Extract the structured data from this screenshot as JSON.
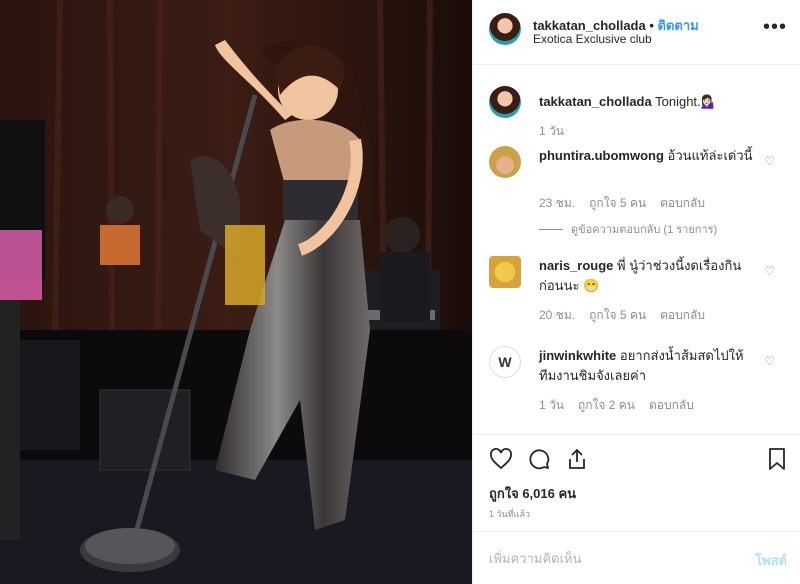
{
  "post": {
    "username": "takkatan_chollada",
    "dot": "•",
    "follow_label": "ติดตาม",
    "location": "Exotica Exclusive club",
    "more_icon": "more-options-icon",
    "caption": {
      "username": "takkatan_chollada",
      "text": "Tonight.💁🏻‍♀️",
      "age": "1 วัน"
    }
  },
  "comments": [
    {
      "username": "phuntira.ubomwong",
      "text": "อ้วนแท้ล่ะเด่วนี้",
      "age": "23 ชม.",
      "likes": "ถูกใจ 5 คน",
      "reply": "ตอบกลับ",
      "view_replies": "ดูข้อความตอบกลับ (1 รายการ)"
    },
    {
      "username": "naris_rouge",
      "text": "พี่ นู๋ว่าช่วงนี้งดเรื่องกินก่อนนะ 😁",
      "age": "20 ชม.",
      "likes": "ถูกใจ 5 คน",
      "reply": "ตอบกลับ"
    },
    {
      "username": "jinwinkwhite",
      "text": "อยากส่งน้ำส้มสดไปให้ทีมงานชิมจังเลยค่า",
      "age": "1 วัน",
      "likes": "ถูกใจ 2 คน",
      "reply": "ตอบกลับ"
    }
  ],
  "actions": {
    "likes": "ถูกใจ 6,016 คน",
    "time": "1 วันที่แล้ว"
  },
  "add_comment": {
    "placeholder": "เพิ่มความคิดเห็น",
    "post_label": "โพสต์"
  },
  "colors": {
    "link": "#3897f0",
    "muted": "#8e8e8e",
    "text": "#262626",
    "post_disabled": "#b2dffc"
  }
}
